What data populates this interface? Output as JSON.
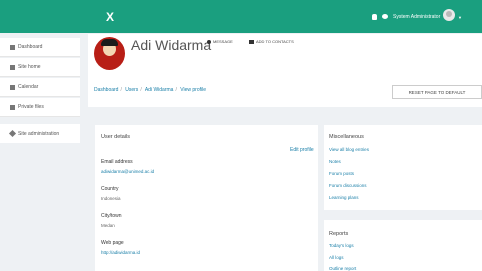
{
  "topbar": {
    "brand": "X",
    "user_name": "System Administrator"
  },
  "colors": {
    "topbar": "#1a9f7f",
    "link": "#1a7fa8"
  },
  "sidebar": {
    "items": [
      {
        "label": "Dashboard",
        "icon": "tachometer-icon"
      },
      {
        "label": "Site home",
        "icon": "home-icon"
      },
      {
        "label": "Calendar",
        "icon": "calendar-icon"
      },
      {
        "label": "Private files",
        "icon": "file-icon"
      }
    ],
    "admin": {
      "label": "Site administration",
      "icon": "wrench-icon"
    }
  },
  "profile": {
    "name": "Adi Widarma",
    "message_label": "MESSAGE",
    "contacts_label": "ADD TO CONTACTS"
  },
  "breadcrumb": [
    "Dashboard",
    "Users",
    "Adi Widarma",
    "View profile"
  ],
  "reset_button": "RESET PAGE TO DEFAULT",
  "user_details": {
    "title": "User details",
    "edit_label": "Edit profile",
    "email_label": "Email address",
    "email_value": "adiwidarma@unimed.ac.id",
    "country_label": "Country",
    "country_value": "Indonesia",
    "city_label": "City/town",
    "city_value": "Medan",
    "web_label": "Web page",
    "web_value": "http://adiwidarma.id"
  },
  "miscellaneous": {
    "title": "Miscellaneous",
    "links": [
      "View all blog entries",
      "Notes",
      "Forum posts",
      "Forum discussions",
      "Learning plans"
    ]
  },
  "reports": {
    "title": "Reports",
    "links": [
      "Today's logs",
      "All logs",
      "Outline report"
    ]
  }
}
